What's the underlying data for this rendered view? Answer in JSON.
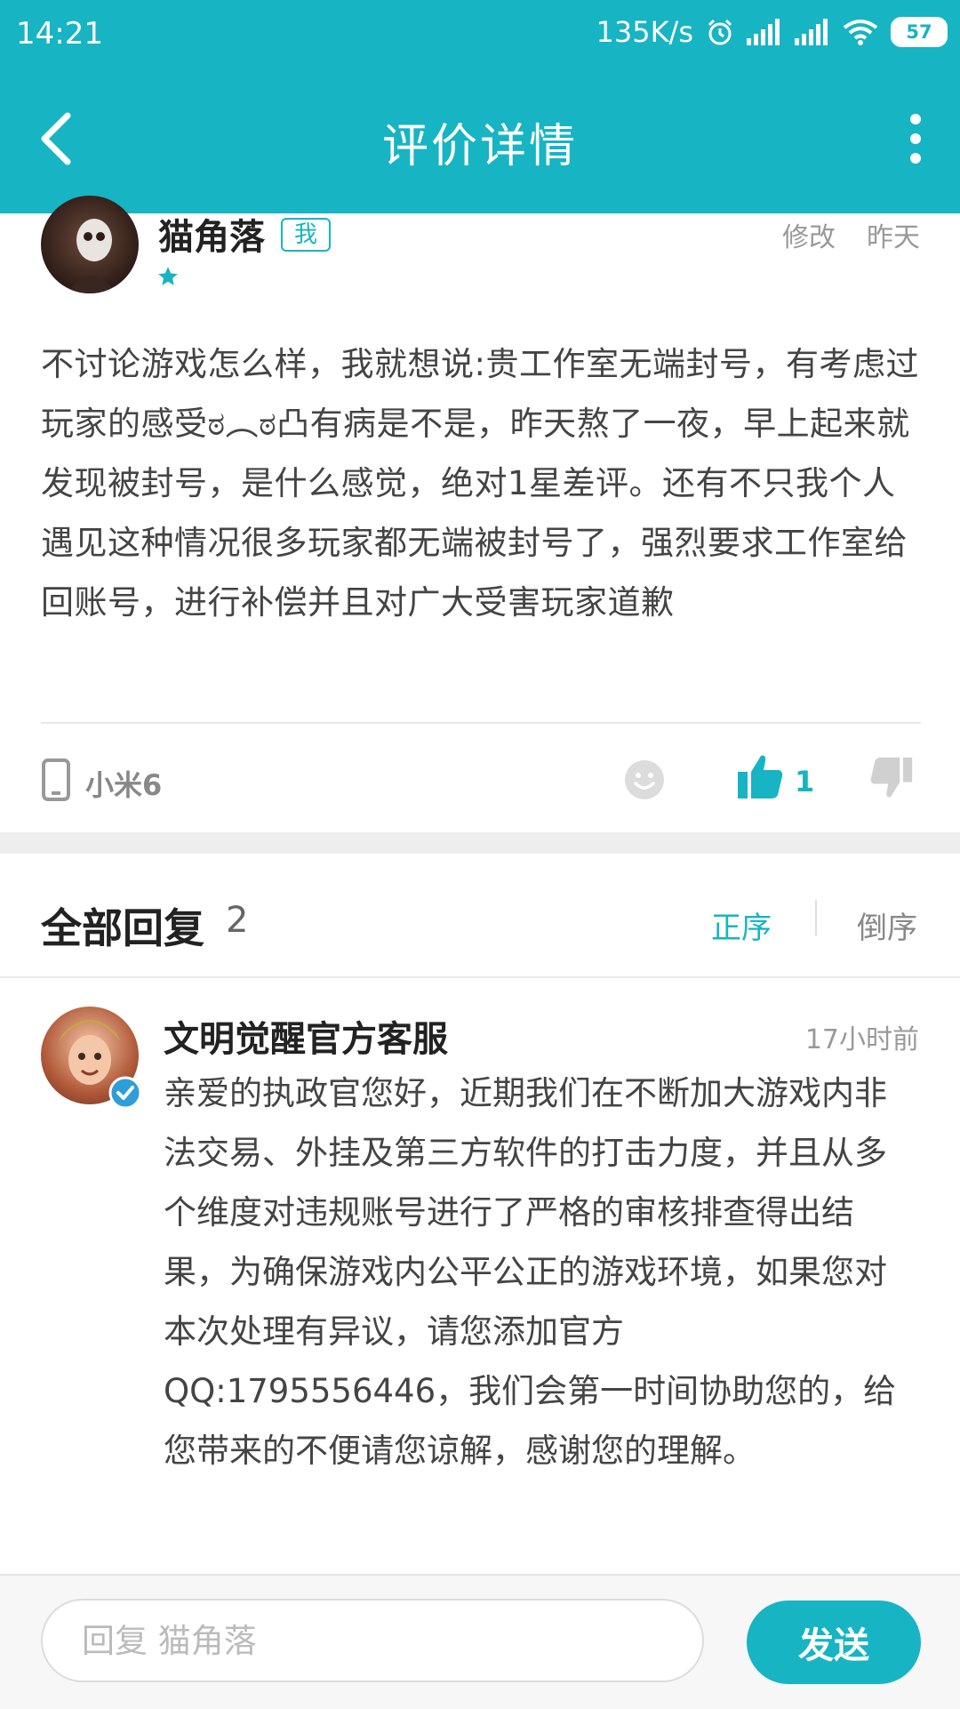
{
  "status_bar": {
    "time": "14:21",
    "speed": "135K/s",
    "battery": "57"
  },
  "nav": {
    "title": "评价详情"
  },
  "review": {
    "username": "猫角落",
    "badge": "我",
    "edit": "修改",
    "date": "昨天",
    "rating_stars": 1,
    "text": "不讨论游戏怎么样，我就想说:贵工作室无端封号，有考虑过玩家的感受ಠ︵ಠ凸有病是不是，昨天熬了一夜，早上起来就发现被封号，是什么感觉，绝对1星差评。还有不只我个人遇见这种情况很多玩家都无端被封号了，强烈要求工作室给回账号，进行补偿并且对广大受害玩家道歉",
    "device": "小米6",
    "like_count": "1"
  },
  "replies": {
    "title": "全部回复",
    "count": "2",
    "sort_asc": "正序",
    "sort_desc": "倒序",
    "items": [
      {
        "author": "文明觉醒官方客服",
        "time": "17小时前",
        "text": "亲爱的执政官您好，近期我们在不断加大游戏内非法交易、外挂及第三方软件的打击力度，并且从多个维度对违规账号进行了严格的审核排查得出结果，为确保游戏内公平公正的游戏环境，如果您对本次处理有异议，请您添加官方QQ:1795556446，我们会第一时间协助您的，给您带来的不便请您谅解，感谢您的理解。"
      }
    ]
  },
  "bottom_bar": {
    "input_placeholder": "回复 猫角落",
    "send_label": "发送"
  },
  "colors": {
    "accent": "#17b4c3",
    "background": "#ffffff",
    "band": "#eeeeee"
  },
  "icons": [
    "back-arrow-icon",
    "more-vertical-icon",
    "alarm-icon",
    "signal-icon",
    "wifi-icon",
    "phone-icon",
    "emoji-icon",
    "thumbs-up-icon",
    "thumbs-down-icon",
    "verified-icon",
    "star-icon"
  ]
}
